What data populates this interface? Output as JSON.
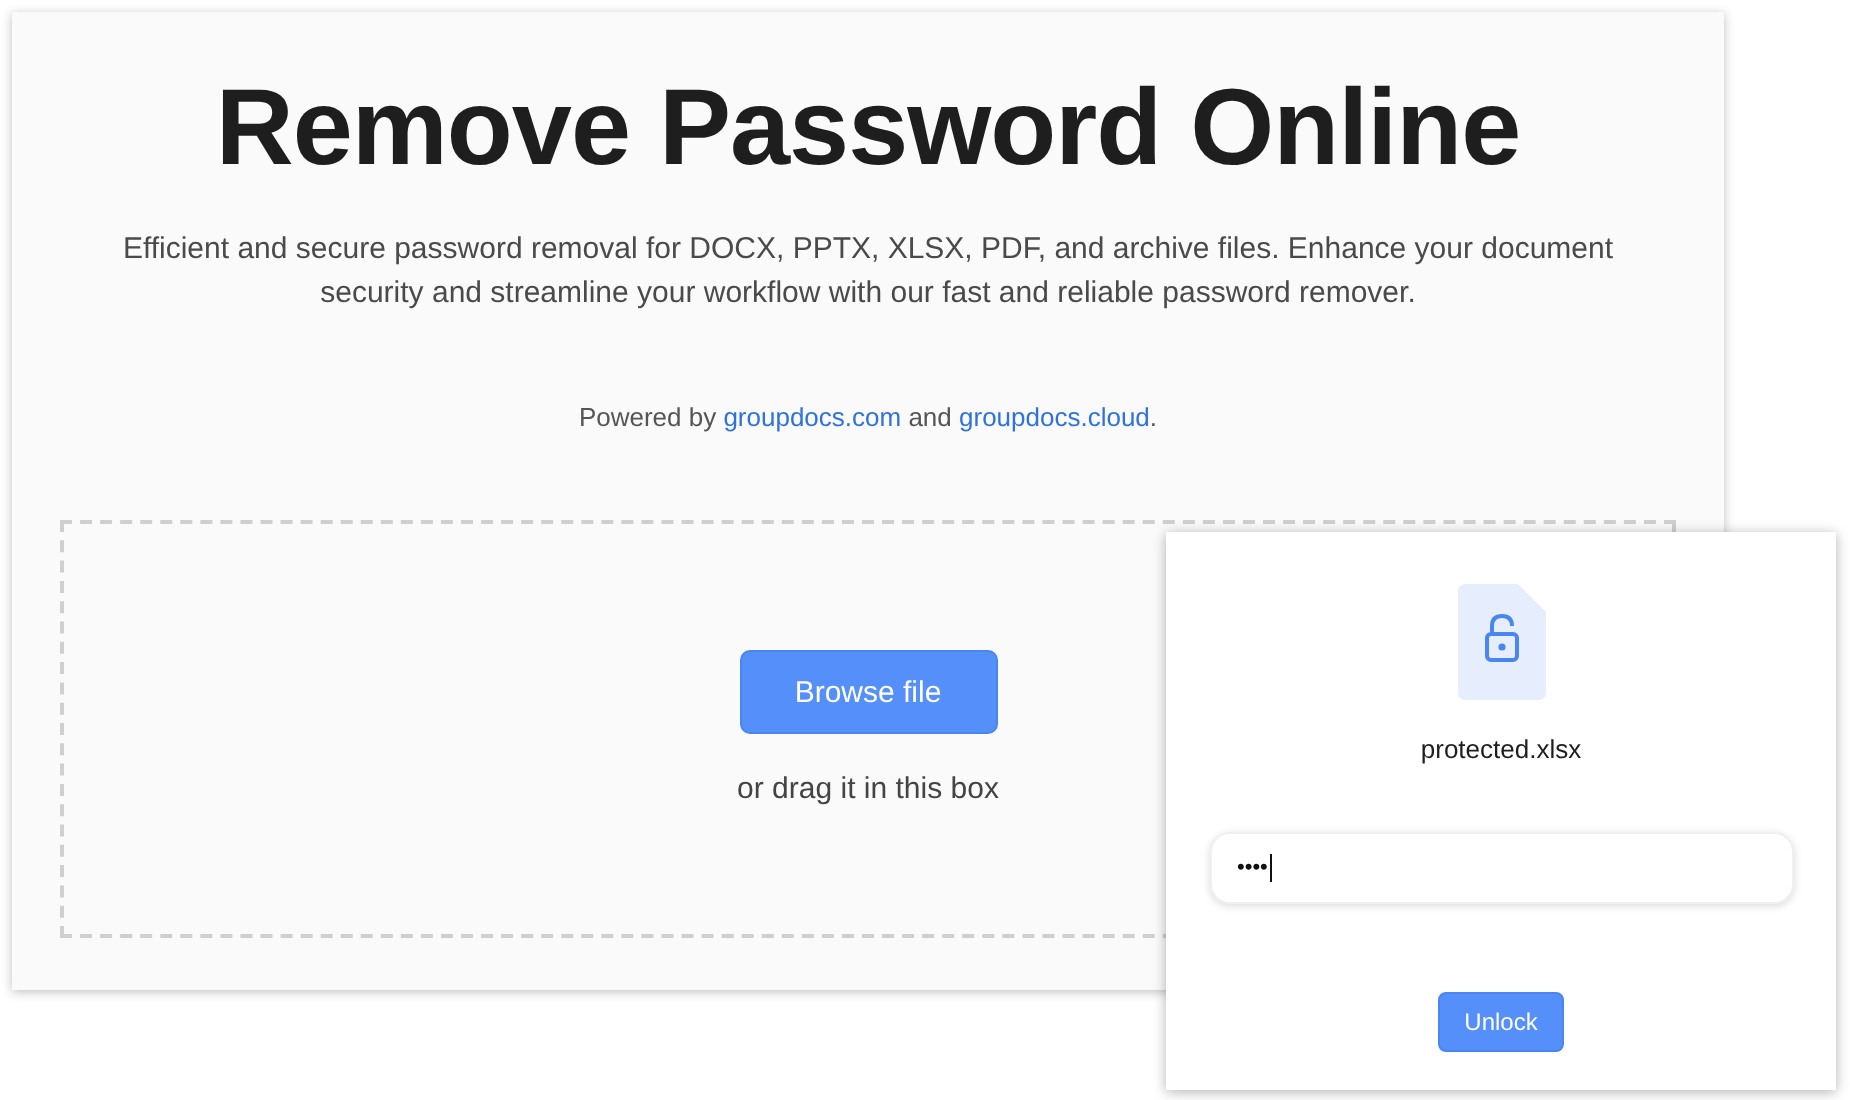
{
  "title": "Remove Password Online",
  "subtitle": "Efficient and secure password removal for DOCX, PPTX, XLSX, PDF, and archive files. Enhance your document security and streamline your workflow with our fast and reliable password remover.",
  "powered_by": [
    {
      "kind": "text",
      "text": "Powered by "
    },
    {
      "kind": "link",
      "text": "groupdocs.com"
    },
    {
      "kind": "text",
      "text": " and "
    },
    {
      "kind": "link",
      "text": "groupdocs.cloud"
    },
    {
      "kind": "text",
      "text": "."
    }
  ],
  "upload": {
    "button": "Browse file",
    "hint": "or drag it in this box"
  },
  "dialog": {
    "file_name": "protected.xlsx",
    "password": {
      "value": "••••"
    },
    "button": "Unlock"
  }
}
